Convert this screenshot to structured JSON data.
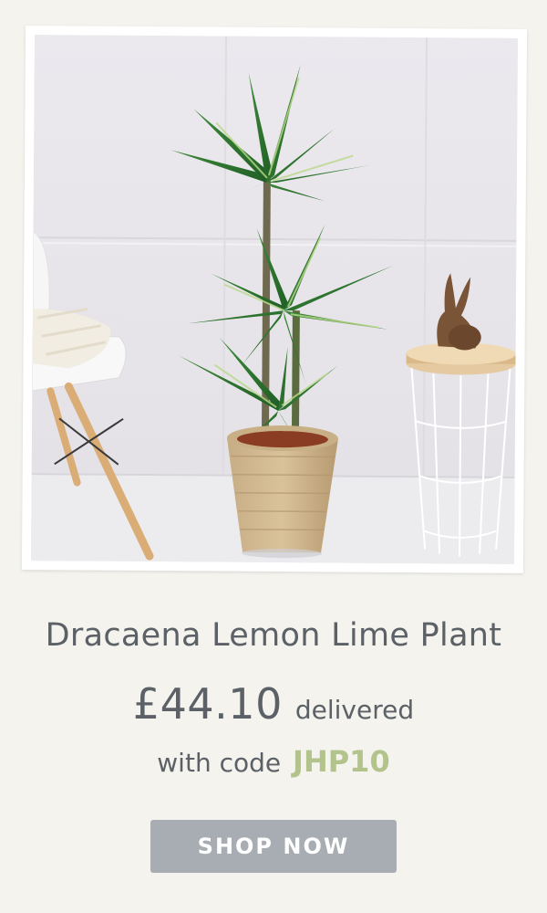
{
  "product": {
    "name": "Dracaena Lemon Lime Plant",
    "price": "£44.10",
    "price_suffix": "delivered",
    "code_prefix": "with code",
    "code": "JHP10",
    "cta_label": "SHOP NOW"
  },
  "colors": {
    "background": "#f4f3ee",
    "text": "#5b6166",
    "code_accent": "#b3c38c",
    "button": "#a7adb2",
    "button_text": "#ffffff"
  },
  "image": {
    "subject": "product-photo"
  }
}
